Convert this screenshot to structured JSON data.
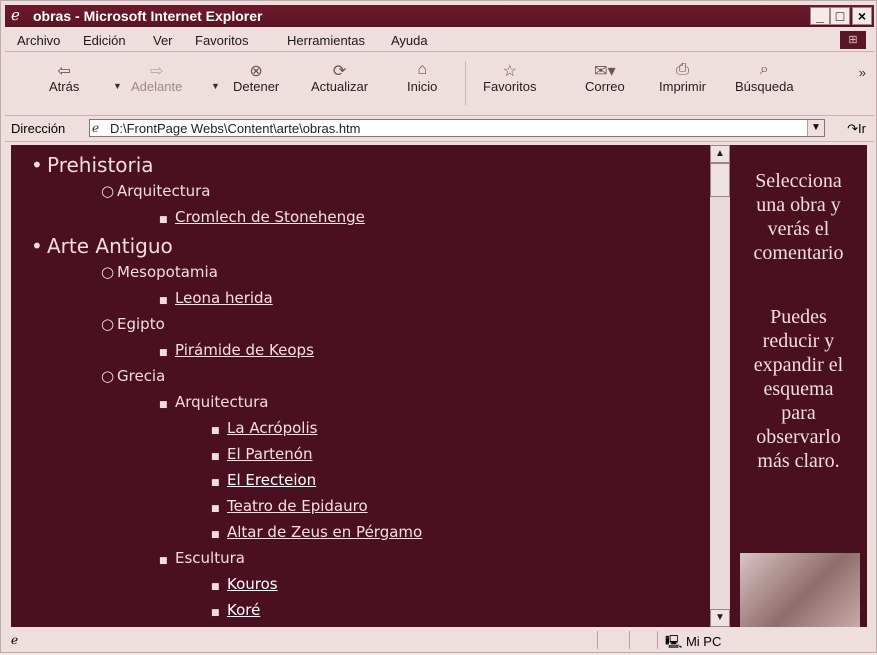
{
  "window": {
    "title": "obras - Microsoft Internet Explorer",
    "buttons": {
      "minimize": "_",
      "maximize": "□",
      "close": "×"
    }
  },
  "menu": [
    {
      "label": "Archivo"
    },
    {
      "label": "Edición"
    },
    {
      "label": "Ver"
    },
    {
      "label": "Favoritos"
    },
    {
      "label": "Herramientas"
    },
    {
      "label": "Ayuda"
    }
  ],
  "toolbar": [
    {
      "label": "Atrás",
      "icon": "back-arrow-icon",
      "enabled": true
    },
    {
      "label": "Adelante",
      "icon": "forward-arrow-icon",
      "enabled": false
    },
    {
      "label": "Detener",
      "icon": "stop-icon",
      "enabled": true
    },
    {
      "label": "Actualizar",
      "icon": "refresh-icon",
      "enabled": true
    },
    {
      "label": "Inicio",
      "icon": "home-icon",
      "enabled": true
    },
    {
      "label": "Favoritos",
      "icon": "favorites-icon",
      "enabled": true
    },
    {
      "label": "Correo",
      "icon": "mail-icon",
      "enabled": true
    },
    {
      "label": "Imprimir",
      "icon": "print-icon",
      "enabled": true
    },
    {
      "label": "Búsqueda",
      "icon": "search-icon",
      "enabled": true
    }
  ],
  "address": {
    "label": "Dirección",
    "value": "D:\\FrontPage Webs\\Content\\arte\\obras.htm",
    "go": "Ir"
  },
  "outline": [
    {
      "text": "Prehistoria",
      "level": 1,
      "link": false
    },
    {
      "text": "Arquitectura",
      "level": 2,
      "link": false
    },
    {
      "text": "Cromlech de Stonehenge",
      "level": 3,
      "link": true
    },
    {
      "text": "Arte Antiguo",
      "level": 1,
      "link": false
    },
    {
      "text": "Mesopotamia",
      "level": 2,
      "link": false
    },
    {
      "text": "Leona herida",
      "level": 3,
      "link": true
    },
    {
      "text": "Egipto",
      "level": 2,
      "link": false
    },
    {
      "text": "Pirámide de Keops",
      "level": 3,
      "link": true
    },
    {
      "text": "Grecia",
      "level": 2,
      "link": false
    },
    {
      "text": "Arquitectura",
      "level": 3,
      "link": false
    },
    {
      "text": "La Acrópolis",
      "level": 4,
      "link": true
    },
    {
      "text": "El Partenón",
      "level": 4,
      "link": true
    },
    {
      "text": "El Erecteion",
      "level": 4,
      "link": true,
      "bright": true
    },
    {
      "text": "Teatro de Epidauro",
      "level": 4,
      "link": true
    },
    {
      "text": "Altar de Zeus en Pérgamo",
      "level": 4,
      "link": true
    },
    {
      "text": "Escultura",
      "level": 3,
      "link": false
    },
    {
      "text": "Kouros",
      "level": 4,
      "link": true,
      "bright": true
    },
    {
      "text": "Koré",
      "level": 4,
      "link": true,
      "bright": true
    }
  ],
  "side": {
    "lines1": [
      "Selecciona",
      "una obra y",
      "verás el",
      "comentario"
    ],
    "lines2": [
      "Puedes",
      "reducir y",
      "expandir el",
      "esquema",
      "para",
      "observarlo",
      "más claro."
    ]
  },
  "status": {
    "zone": "Mi PC"
  },
  "colors": {
    "content_bg": "#4a1020",
    "title_bg": "#5a1423"
  }
}
